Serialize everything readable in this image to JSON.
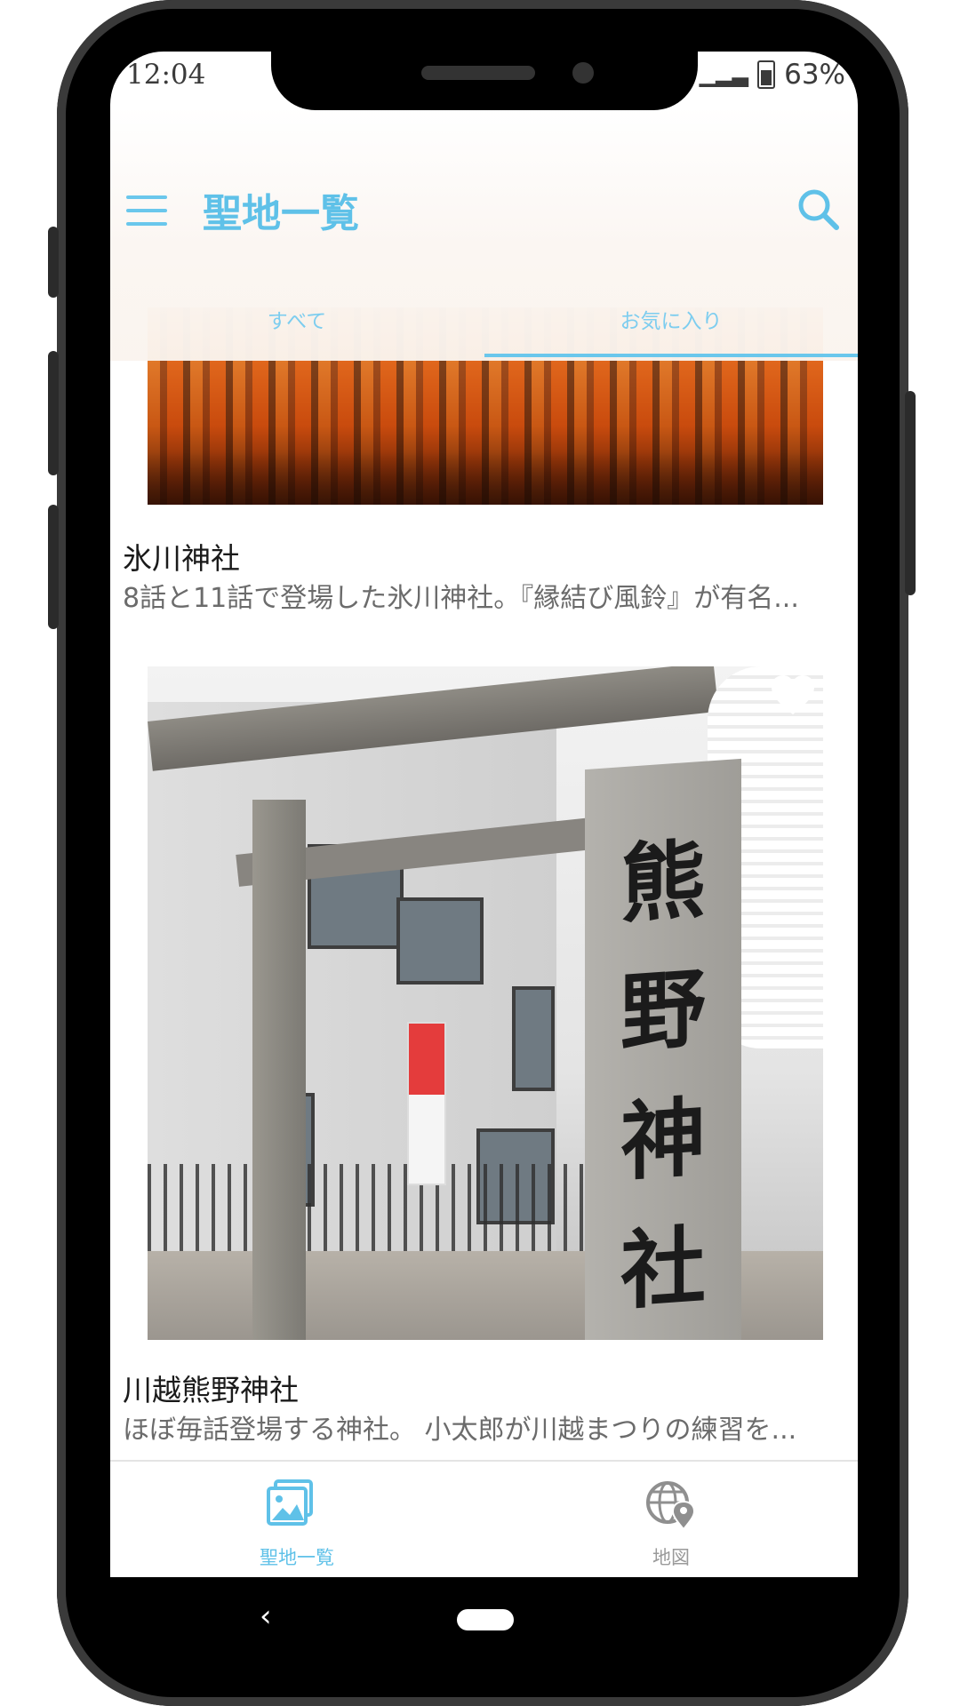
{
  "status_bar": {
    "time": "12:04",
    "battery": "63%"
  },
  "app_bar": {
    "title": "聖地一覧"
  },
  "tabs": [
    {
      "label": "すべて",
      "selected": false
    },
    {
      "label": "お気に入り",
      "selected": true
    }
  ],
  "items": [
    {
      "title": "氷川神社",
      "description": "8話と11話で登場した氷川神社。『縁結び風鈴』が有名..."
    },
    {
      "title": "川越熊野神社",
      "description": "ほぼ毎話登場する神社。 小太郎が川越まつりの練習を...",
      "pillar_text": "熊野神社",
      "favorite": true
    }
  ],
  "bottom_nav": [
    {
      "label": "聖地一覧",
      "active": true,
      "icon": "image-gallery-icon"
    },
    {
      "label": "地図",
      "active": false,
      "icon": "globe-location-icon"
    }
  ],
  "colors": {
    "accent": "#5fc1e8",
    "nav_inactive": "#9a9a9a"
  }
}
